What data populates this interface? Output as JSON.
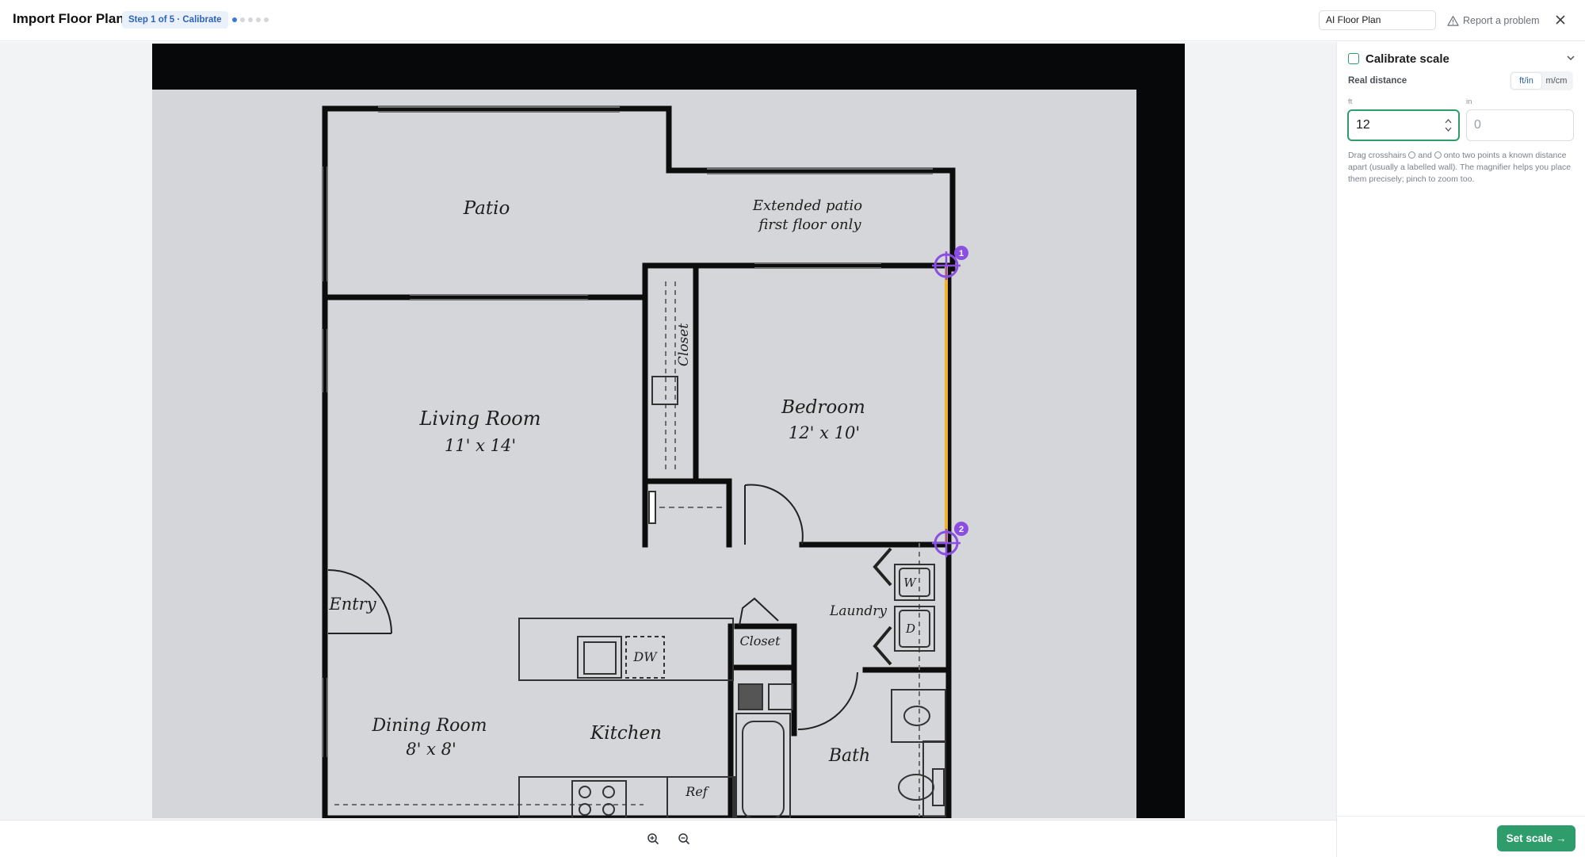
{
  "header": {
    "title": "Import Floor Plan",
    "step_badge": "Step 1 of 5 · Calibrate",
    "steps_total": 5,
    "steps_current": 1,
    "plan_name": "AI Floor Plan",
    "report_label": "Report a problem"
  },
  "floorplan": {
    "rooms": {
      "patio": "Patio",
      "extended_patio_line1": "Extended patio",
      "extended_patio_line2": "first floor only",
      "living_room": "Living Room",
      "living_room_dims": "11' x 14'",
      "bedroom": "Bedroom",
      "bedroom_dims": "12' x 10'",
      "closet_vertical": "Closet",
      "entry": "Entry",
      "laundry": "Laundry",
      "washer": "W",
      "dryer": "D",
      "closet_small": "Closet",
      "dishwasher": "DW",
      "dining_room": "Dining Room",
      "dining_room_dims": "8' x 8'",
      "kitchen": "Kitchen",
      "bath": "Bath",
      "fridge": "Ref"
    },
    "markers": [
      {
        "label": "1"
      },
      {
        "label": "2"
      }
    ],
    "colors": {
      "marker": "#8a4fe0",
      "measure_line": "#f0b429",
      "sheet": "#d5d6d9",
      "frame": "#07080a",
      "walls": "#0d0d0d"
    }
  },
  "panel": {
    "title": "Calibrate scale",
    "real_distance_label": "Real distance",
    "units": [
      {
        "label": "ft/in",
        "selected": true
      },
      {
        "label": "m/cm",
        "selected": false
      }
    ],
    "ft_label": "ft",
    "ft_value": "12",
    "in_label": "in",
    "in_placeholder": "0",
    "helper_before": "Drag crosshairs",
    "helper_and": "and",
    "helper_after": "onto two points a known distance apart (usually a labelled wall). The magnifier helps you place them precisely; pinch to zoom too.",
    "set_scale_label": "Set scale →"
  },
  "colors": {
    "accent_green": "#2f9c6c",
    "accent_blue": "#2d63b8"
  },
  "icons": {
    "report": "warning-triangle-icon",
    "close": "close-icon",
    "chevron": "chevron-down-icon",
    "zoom_in": "zoom-in-icon",
    "zoom_out": "zoom-out-icon"
  }
}
